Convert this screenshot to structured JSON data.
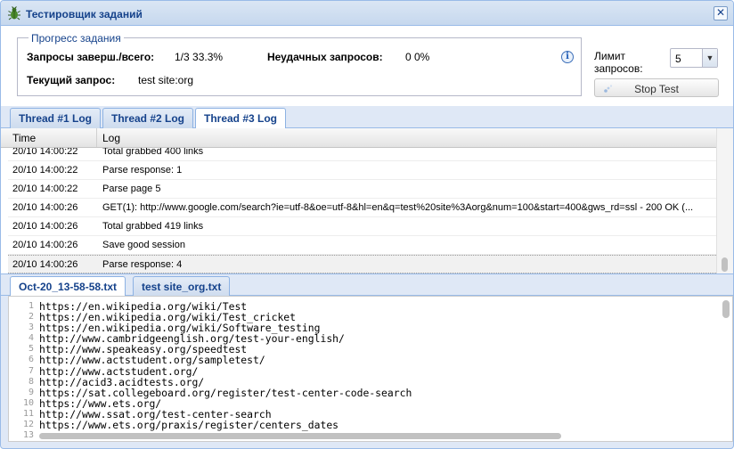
{
  "window": {
    "title": "Тестировщик заданий",
    "close_glyph": "✕",
    "icon": "bug-icon"
  },
  "progress": {
    "legend": "Прогресс задания",
    "done_label": "Запросы заверш./всего:",
    "done_value": "1/3 33.3%",
    "failed_label": "Неудачных запросов:",
    "failed_value": "0 0%",
    "current_label": "Текущий запрос:",
    "current_value": "test site:org",
    "info_glyph": "i"
  },
  "controls": {
    "limit_label": "Лимит запросов:",
    "limit_value": "5",
    "stop_label": "Stop Test"
  },
  "thread_tabs": [
    {
      "label": "Thread #1 Log",
      "active": false
    },
    {
      "label": "Thread #2 Log",
      "active": false
    },
    {
      "label": "Thread #3 Log",
      "active": true
    }
  ],
  "log": {
    "columns": {
      "time": "Time",
      "log": "Log"
    },
    "rows": [
      {
        "time": "20/10 14:00:22",
        "log": "Total grabbed 400 links"
      },
      {
        "time": "20/10 14:00:22",
        "log": "Parse response: 1"
      },
      {
        "time": "20/10 14:00:22",
        "log": "Parse page 5"
      },
      {
        "time": "20/10 14:00:26",
        "log": "GET(1): http://www.google.com/search?ie=utf-8&oe=utf-8&hl=en&q=test%20site%3Aorg&num=100&start=400&gws_rd=ssl - 200 OK (..."
      },
      {
        "time": "20/10 14:00:26",
        "log": "Total grabbed 419 links"
      },
      {
        "time": "20/10 14:00:26",
        "log": "Save good session"
      },
      {
        "time": "20/10 14:00:26",
        "log": "Parse response: 4"
      }
    ]
  },
  "file_tabs": [
    {
      "label": "Oct-20_13-58-58.txt",
      "active": true
    },
    {
      "label": "test site_org.txt",
      "active": false
    }
  ],
  "editor": {
    "lines": [
      "https://en.wikipedia.org/wiki/Test",
      "https://en.wikipedia.org/wiki/Test_cricket",
      "https://en.wikipedia.org/wiki/Software_testing",
      "http://www.cambridgeenglish.org/test-your-english/",
      "http://www.speakeasy.org/speedtest",
      "http://www.actstudent.org/sampletest/",
      "http://www.actstudent.org/",
      "http://acid3.acidtests.org/",
      "https://sat.collegeboard.org/register/test-center-code-search",
      "https://www.ets.org/",
      "http://www.ssat.org/test-center-search",
      "https://www.ets.org/praxis/register/centers_dates",
      ""
    ]
  }
}
